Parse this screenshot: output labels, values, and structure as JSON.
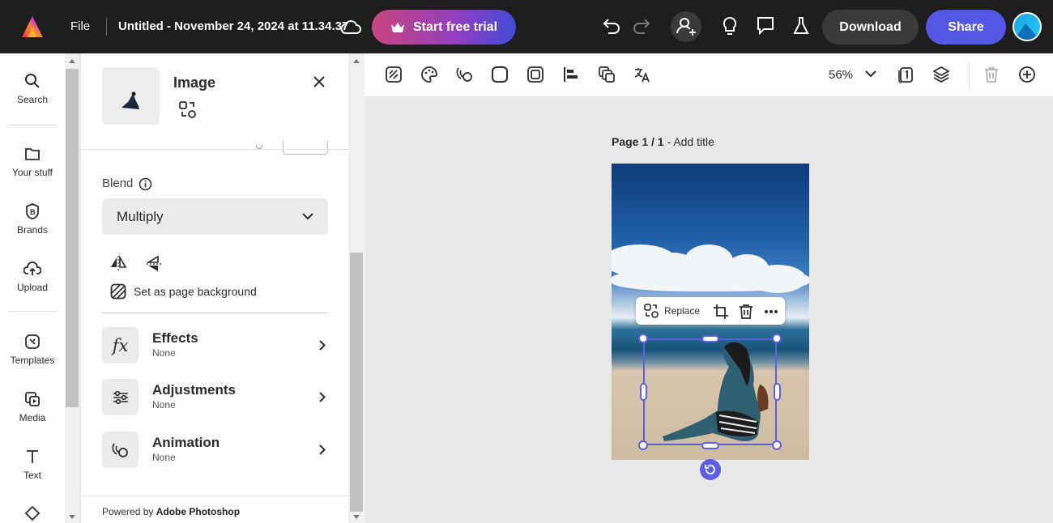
{
  "topbar": {
    "file_label": "File",
    "doc_title": "Untitled - November 24, 2024 at 11.34.37",
    "trial_label": "Start free trial",
    "download_label": "Download",
    "share_label": "Share"
  },
  "rail": {
    "items": [
      {
        "label": "Search",
        "icon": "search-icon"
      },
      {
        "label": "Your stuff",
        "icon": "folder-icon"
      },
      {
        "label": "Brands",
        "icon": "brand-icon"
      },
      {
        "label": "Upload",
        "icon": "upload-icon"
      },
      {
        "label": "Templates",
        "icon": "templates-icon"
      },
      {
        "label": "Media",
        "icon": "media-icon"
      },
      {
        "label": "Text",
        "icon": "text-icon"
      }
    ]
  },
  "panel": {
    "title": "Image",
    "blend_label": "Blend",
    "blend_value": "Multiply",
    "set_bg_label": "Set as page background",
    "effects": {
      "title": "Effects",
      "value": "None",
      "icon": "fx"
    },
    "adjustments": {
      "title": "Adjustments",
      "value": "None"
    },
    "animation": {
      "title": "Animation",
      "value": "None"
    },
    "powered_prefix": "Powered by ",
    "powered_brand": "Adobe Photoshop"
  },
  "toolbar": {
    "zoom": "56%"
  },
  "canvas": {
    "page_num": "Page 1 / 1",
    "page_sep": " - ",
    "add_title": "Add title",
    "replace_label": "Replace"
  },
  "colors": {
    "accent": "#5b5fe0",
    "share": "#5258e4",
    "topbar": "#1e1e1e"
  }
}
